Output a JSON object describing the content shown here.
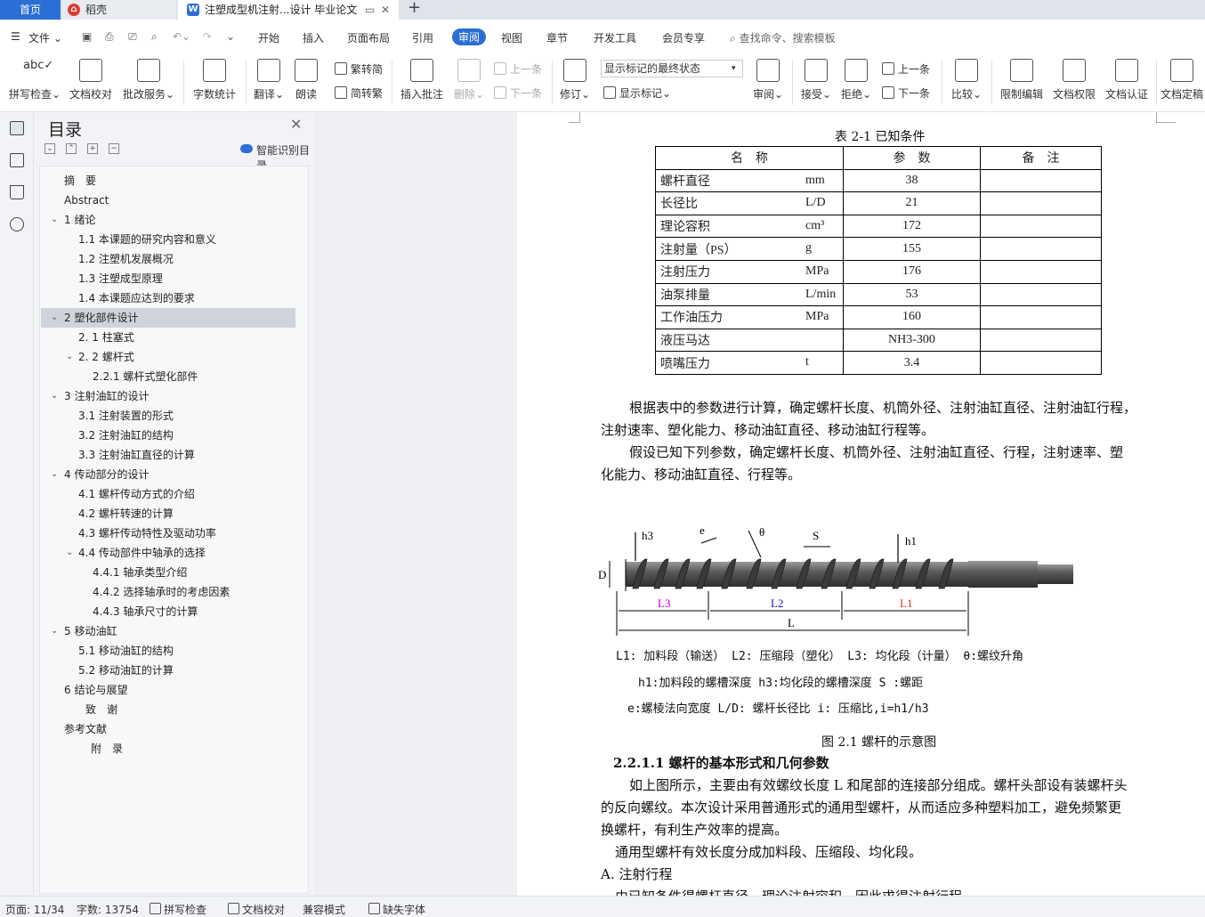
{
  "tabs": {
    "home": "首页",
    "daoke": "稻壳",
    "doc": "注塑成型机注射...设计 毕业论文",
    "new": "+"
  },
  "menubar": {
    "file": "文件",
    "items": [
      "开始",
      "插入",
      "页面布局",
      "引用",
      "审阅",
      "视图",
      "章节",
      "开发工具",
      "会员专享"
    ],
    "search": "查找命令、搜索模板"
  },
  "ribbon": {
    "spell": "拼写检查",
    "proof": "文档校对",
    "batch": "批改服务",
    "wordcount": "字数统计",
    "translate": "翻译",
    "read": "朗读",
    "t2s": "繁转简",
    "s2t": "简转繁",
    "insert_comment": "插入批注",
    "delete": "删除",
    "prev": "上一条",
    "next": "下一条",
    "revise": "修订",
    "markup_select": "显示标记的最终状态",
    "show_markup": "显示标记",
    "review": "审阅",
    "accept": "接受",
    "reject": "拒绝",
    "prev2": "上一条",
    "next2": "下一条",
    "compare": "比较",
    "restrict": "限制编辑",
    "doc_rights": "文档权限",
    "doc_cert": "文档认证",
    "doc_final": "文档定稿"
  },
  "toc": {
    "title": "目录",
    "smart": "智能识别目录",
    "items": [
      "摘　要",
      "Abstract",
      "1  绪论",
      "1.1  本课题的研究内容和意义",
      "1.2  注塑机发展概况",
      "1.3 注塑成型原理",
      "1.4 本课题应达到的要求",
      "2  塑化部件设计",
      "2.  1 柱塞式",
      "2.  2  螺杆式",
      "2.2.1  螺杆式塑化部件",
      "3  注射油缸的设计",
      "3.1  注射装置的形式",
      "3.2  注射油缸的结构",
      "3.3  注射油缸直径的计算",
      "4  传动部分的设计",
      "4.1  螺杆传动方式的介绍",
      "4.2  螺杆转速的计算",
      "4.3  螺杆传动特性及驱动功率",
      "4.4 传动部件中轴承的选择",
      "4.4.1  轴承类型介绍",
      "4.4.2  选择轴承时的考虑因素",
      "4.4.3  轴承尺寸的计算",
      "5  移动油缸",
      "5.1  移动油缸的结构",
      "5.2  移动油缸的计算",
      "6  结论与展望",
      "致　谢",
      "参考文献",
      "附　录"
    ]
  },
  "doc": {
    "table_caption": "表 2-1 已知条件",
    "table_header": [
      "名　称",
      "参　数",
      "备　注"
    ],
    "table_rows": [
      {
        "name": "螺杆直径",
        "unit": "mm",
        "value": "38"
      },
      {
        "name": "长径比",
        "unit": "L/D",
        "value": "21"
      },
      {
        "name": "理论容积",
        "unit": "cm³",
        "value": "172"
      },
      {
        "name": "注射量（PS）",
        "unit": "g",
        "value": "155"
      },
      {
        "name": "注射压力",
        "unit": "MPa",
        "value": "176"
      },
      {
        "name": "油泵排量",
        "unit": "L/min",
        "value": "53"
      },
      {
        "name": "工作油压力",
        "unit": "MPa",
        "value": "160"
      },
      {
        "name": "液压马达",
        "unit": "",
        "value": "NH3-300"
      },
      {
        "name": "喷嘴压力",
        "unit": "t",
        "value": "3.4"
      }
    ],
    "para1a": "根据表中的参数进行计算，确定螺杆长度、机筒外径、注射油缸直径、注射油缸行程，",
    "para1b": "注射速率、塑化能力、移动油缸直径、移动油缸行程等。",
    "para2a": "假设已知下列参数，确定螺杆长度、机筒外径、注射油缸直径、行程，注射速率、塑",
    "para2b": "化能力、移动油缸直径、行程等。",
    "fig_labels": {
      "h3": "h3",
      "e": "e",
      "theta": "θ",
      "S": "S",
      "h1": "h1",
      "D": "D",
      "L3": "L3",
      "L2": "L2",
      "L1": "L1",
      "L": "L"
    },
    "legend1": "L1: 加料段（输送）  L2: 压缩段（塑化）    L3: 均化段（计量）  θ:螺纹升角",
    "legend2": "h1:加料段的螺槽深度     h3:均化段的螺槽深度       S :螺距",
    "legend3": "e:螺棱法向宽度       L/D: 螺杆长径比       i: 压缩比,i=h1/h3",
    "fig_caption": "图 2.1 螺杆的示意图",
    "heading": "2.2.1.1 螺杆的基本形式和几何参数",
    "para3a": "如上图所示，主要由有效螺纹长度 L 和尾部的连接部分组成。螺杆头部设有装螺杆头",
    "para3b": "的反向螺纹。本次设计采用普通形式的通用型螺杆，从而适应多种塑料加工，避免频繁更",
    "para3c": "换螺杆，有利生产效率的提高。",
    "para4": "通用型螺杆有效长度分成加料段、压缩段、均化段。",
    "heading2": "A.  注射行程",
    "para5": "由已知条件得螺杆直径、理论注射容积，因此求得注射行程"
  },
  "status": {
    "page": "页面: 11/34",
    "words": "字数: 13754",
    "spell": "拼写检查",
    "proof": "文档校对",
    "compat": "兼容模式",
    "font": "缺失字体"
  }
}
